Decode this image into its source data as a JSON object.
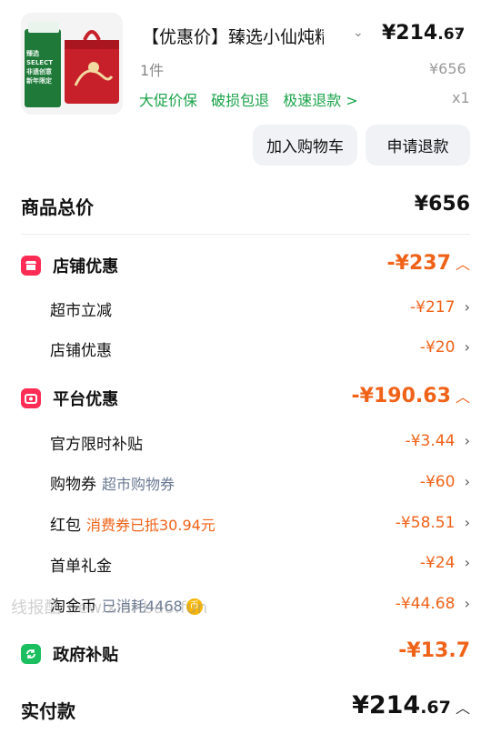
{
  "product": {
    "image_icon": "gift-box-image",
    "title": "【优惠价】臻选小仙炖精",
    "price_int": "¥214",
    "price_dec": ".67",
    "quantity_label": "1件",
    "original_price": "¥656",
    "tags": [
      "大促价保",
      "破损包退",
      "极速退款 >"
    ],
    "count": "x1",
    "image_text": [
      "非遗创意",
      "新年限定",
      "臻选SELECT"
    ]
  },
  "actions": {
    "add_to_cart": "加入购物车",
    "request_refund": "申请退款"
  },
  "summary": {
    "goods_total_label": "商品总价",
    "goods_total_value": "¥656"
  },
  "sections": {
    "store": {
      "label": "店铺优惠",
      "amount": "-¥237",
      "icon_color": "#ff2d55",
      "items": [
        {
          "label": "超市立减",
          "amount": "-¥217"
        },
        {
          "label": "店铺优惠",
          "amount": "-¥20"
        }
      ]
    },
    "platform": {
      "label": "平台优惠",
      "amount": "-¥190.63",
      "icon_color": "#ff2d55",
      "items": [
        {
          "label": "官方限时补贴",
          "note": "",
          "amount": "-¥3.44"
        },
        {
          "label": "购物券",
          "note": "超市购物券",
          "amount": "-¥60"
        },
        {
          "label": "红包",
          "note": "消费券已抵30.94元",
          "amount": "-¥58.51"
        },
        {
          "label": "首单礼金",
          "note": "",
          "amount": "-¥24"
        },
        {
          "label": "淘金币",
          "note": "已消耗4468",
          "amount": "-¥44.68"
        }
      ]
    },
    "government": {
      "label": "政府补贴",
      "amount": "-¥13.7",
      "icon_color": "#1bbf5f"
    }
  },
  "total": {
    "label": "实付款",
    "amount_int": "¥214",
    "amount_dec": ".67"
  },
  "watermark": "线报酷 new.xianbao.fun"
}
